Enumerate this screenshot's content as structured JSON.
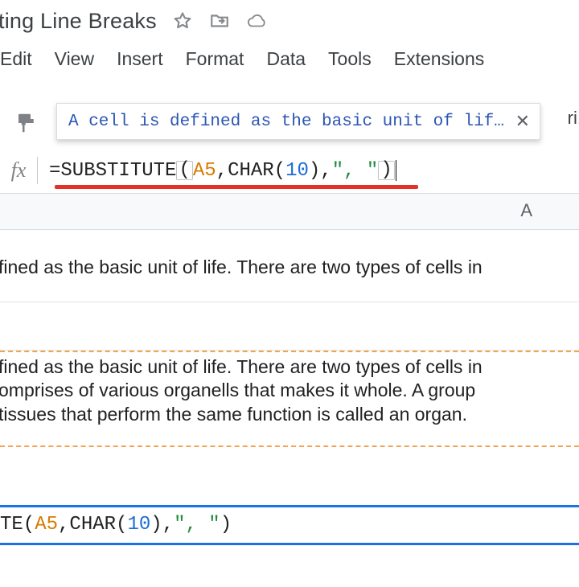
{
  "doc": {
    "title": "ting Line Breaks"
  },
  "menu": {
    "edit": "Edit",
    "view": "View",
    "insert": "Insert",
    "format": "Format",
    "data": "Data",
    "tools": "Tools",
    "extensions": "Extensions"
  },
  "toolbar": {
    "right_fragment": "ri.",
    "preview_text": "A cell is defined as the basic unit of lif…"
  },
  "formula": {
    "fx": "fx",
    "prefix": "=SUBSTITUTE",
    "open_paren": "(",
    "ref": "A5",
    "comma1": ",",
    "char_fn": "CHAR",
    "char_open": "(",
    "char_num": "10",
    "char_close": ")",
    "comma2": ",",
    "str": "\", \"",
    "close_paren": ")"
  },
  "grid": {
    "col_label": "A",
    "a1": "fined as the basic unit of life. There are two types of cells in",
    "a3_line1": "fined as the basic unit of life. There are two types of cells in",
    "a3_line2": "omprises of various organells that makes it whole. A group",
    "a3_line3": "tissues that perform the same function is called an organ.",
    "a5_prefix": "TE(",
    "a5_ref": "A5",
    "a5_mid1": ",CHAR(",
    "a5_num": "10",
    "a5_mid2": "),",
    "a5_str": "\", \"",
    "a5_end": ")"
  }
}
